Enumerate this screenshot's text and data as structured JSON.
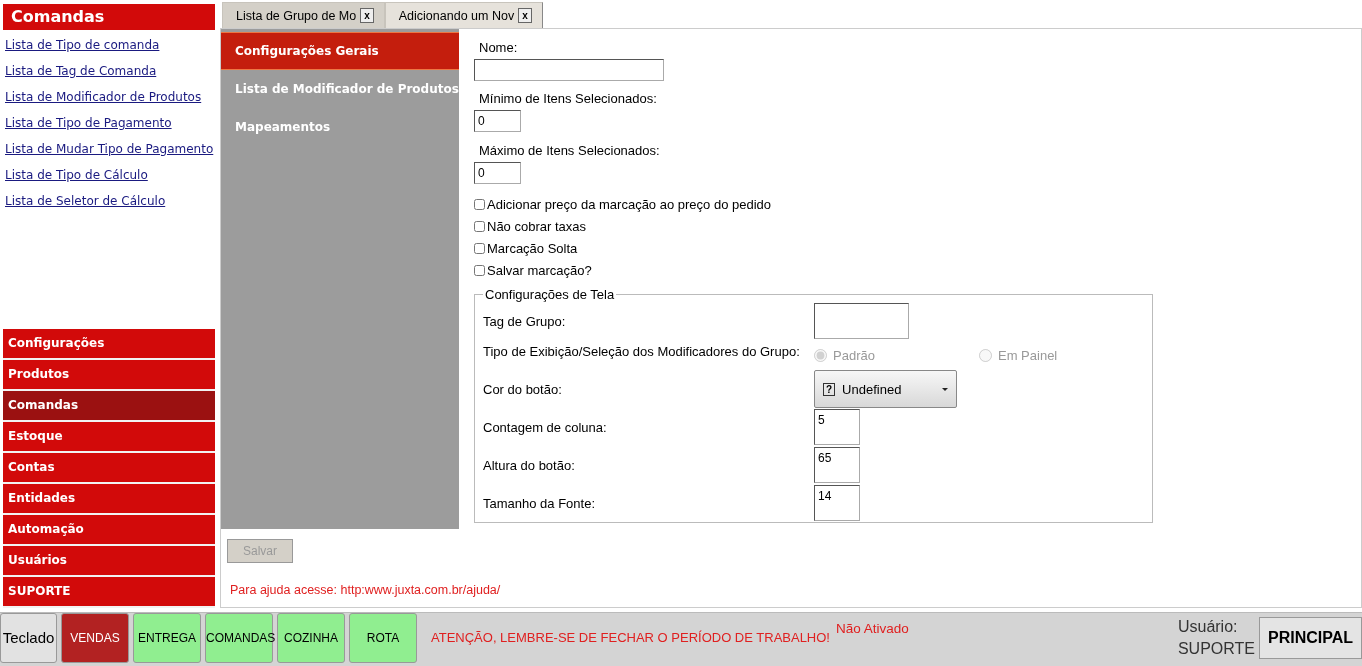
{
  "sidebar": {
    "title": "Comandas",
    "links": [
      "Lista de Tipo de comanda",
      "Lista de Tag de Comanda",
      "Lista de Modificador de Produtos",
      "Lista de Tipo de Pagamento",
      "Lista de Mudar Tipo de Pagamento",
      "Lista de Tipo de Cálculo",
      "Lista de Seletor de Cálculo"
    ],
    "nav": [
      {
        "label": "Configurações",
        "selected": false
      },
      {
        "label": "Produtos",
        "selected": false
      },
      {
        "label": "Comandas",
        "selected": true
      },
      {
        "label": "Estoque",
        "selected": false
      },
      {
        "label": "Contas",
        "selected": false
      },
      {
        "label": "Entidades",
        "selected": false
      },
      {
        "label": "Automação",
        "selected": false
      },
      {
        "label": "Usuários",
        "selected": false
      },
      {
        "label": "SUPORTE",
        "selected": false
      }
    ]
  },
  "tabs": [
    {
      "label": "Lista de Grupo de Mo",
      "close": "x",
      "selected": false
    },
    {
      "label": "Adicionando um Nov",
      "close": "x",
      "selected": true
    }
  ],
  "side_menu": [
    {
      "label": "Configurações Gerais",
      "selected": true
    },
    {
      "label": "Lista de Modificador de Produtos",
      "selected": false
    },
    {
      "label": "Mapeamentos",
      "selected": false
    }
  ],
  "form": [
    {
      "kind": "text",
      "label": "Nome:"
    },
    {
      "kind": "number",
      "label": "Mínimo de Itens Selecionados:",
      "value": "0"
    },
    {
      "kind": "number",
      "label": "Máximo de Itens Selecionados:",
      "value": "0"
    },
    {
      "kind": "checkbox",
      "label": "Adicionar preço da marcação ao preço do pedido",
      "checked": false
    },
    {
      "kind": "checkbox",
      "label": "Não cobrar taxas",
      "checked": false
    },
    {
      "kind": "checkbox",
      "label": "Marcação Solta",
      "checked": false
    },
    {
      "kind": "checkbox",
      "label": "Salvar marcação?",
      "checked": false
    }
  ],
  "screen_settings": {
    "legend": "Configurações de Tela",
    "rows": [
      {
        "kind": "text",
        "label": "Tag de Grupo:"
      },
      {
        "kind": "radio",
        "label": "Tipo de Exibição/Seleção dos Modificadores do Grupo:",
        "disabled": true,
        "options": [
          {
            "label": "Padrão",
            "selected": true
          },
          {
            "label": "Em Painel",
            "selected": false
          }
        ]
      },
      {
        "kind": "dropdown",
        "label": "Cor do botão:",
        "icon": "?",
        "value": "Undefined"
      },
      {
        "kind": "number",
        "label": "Contagem de coluna:",
        "value": "5"
      },
      {
        "kind": "number",
        "label": "Altura do botão:",
        "value": "65"
      },
      {
        "kind": "number",
        "label": "Tamanho da Fonte:",
        "value": "14"
      }
    ]
  },
  "save_button": {
    "label": "Salvar",
    "disabled": true
  },
  "help_text": "Para ajuda acesse: http:www.juxta.com.br/ajuda/",
  "taskbar": {
    "buttons": [
      {
        "kind": "keyboard",
        "label": "Teclado",
        "selected": false
      },
      {
        "kind": "module",
        "label": "VENDAS",
        "selected": true
      },
      {
        "kind": "module",
        "label": "ENTREGA",
        "selected": false
      },
      {
        "kind": "module",
        "label": "COMANDAS",
        "selected": false
      },
      {
        "kind": "module",
        "label": "COZINHA",
        "selected": false
      },
      {
        "kind": "module",
        "label": "ROTA",
        "selected": false
      }
    ],
    "warning": "ATENÇÃO, LEMBRE-SE DE FECHAR O PERÍODO DE TRABALHO!",
    "activation": "Não Ativado",
    "user_label": "Usuário:",
    "user_name": "SUPORTE",
    "main_button": "PRINCIPAL"
  }
}
